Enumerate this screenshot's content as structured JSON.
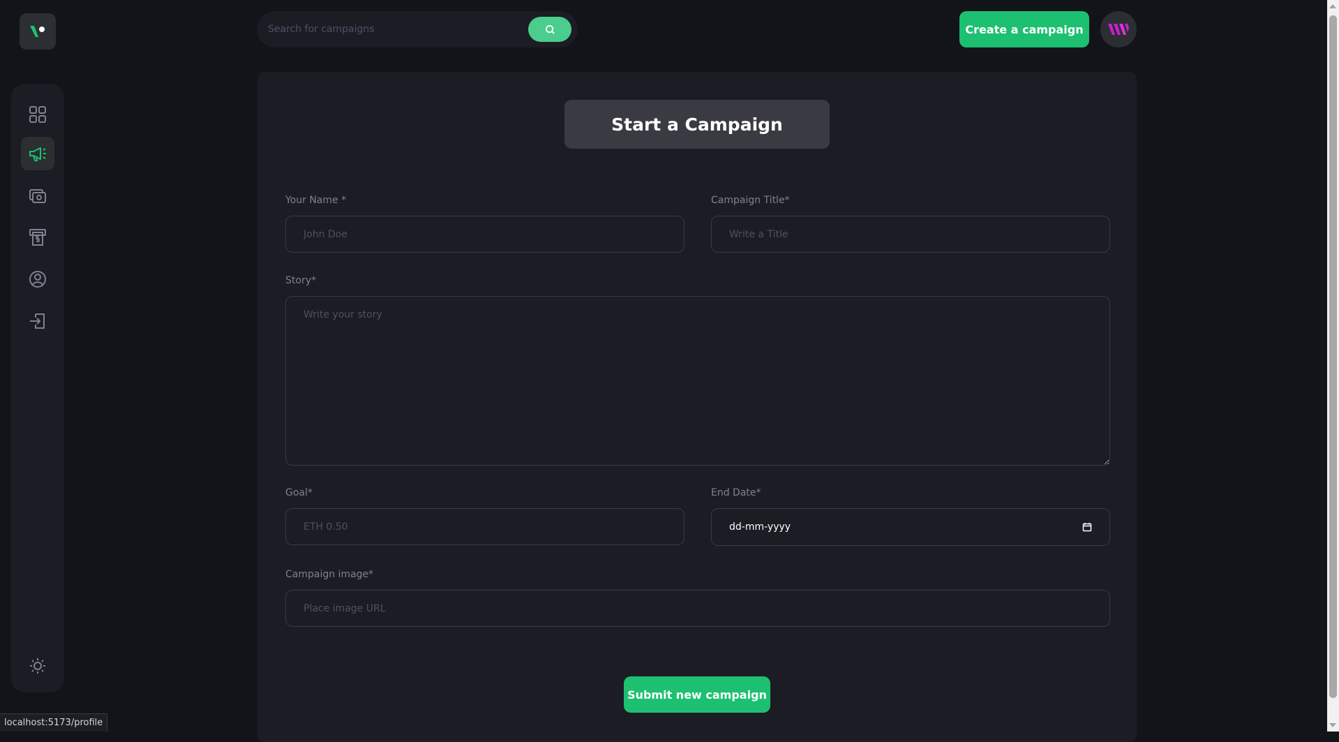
{
  "header": {
    "search_placeholder": "Search for campaigns",
    "create_label": "Create a campaign"
  },
  "sidebar": {
    "items": [
      {
        "icon": "dashboard-icon"
      },
      {
        "icon": "campaign-megaphone-icon",
        "active": true
      },
      {
        "icon": "payment-icon"
      },
      {
        "icon": "withdraw-icon"
      },
      {
        "icon": "profile-icon"
      },
      {
        "icon": "logout-icon"
      }
    ],
    "theme_icon": "sun-icon"
  },
  "form": {
    "title": "Start a Campaign",
    "name_label": "Your Name *",
    "name_placeholder": "John Doe",
    "title_label": "Campaign Title*",
    "title_placeholder": "Write a Title",
    "story_label": "Story*",
    "story_placeholder": "Write your story",
    "goal_label": "Goal*",
    "goal_placeholder": "ETH 0.50",
    "enddate_label": "End Date*",
    "enddate_value": "dd-mm-yyyy",
    "image_label": "Campaign image*",
    "image_placeholder": "Place image URL",
    "submit_label": "Submit new campaign"
  },
  "status_bar": {
    "url": "localhost:5173/profile"
  },
  "colors": {
    "background": "#13131a",
    "card": "#1c1c24",
    "accent_green": "#1dc071",
    "search_green": "#4acd8d",
    "logo_pink": "#c81fd0"
  }
}
